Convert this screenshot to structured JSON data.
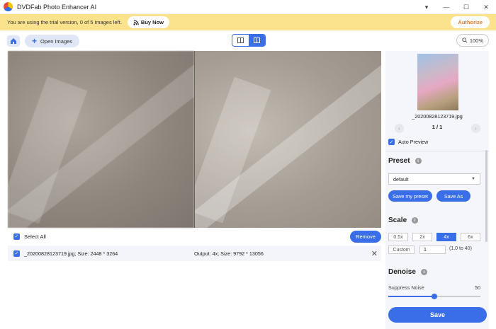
{
  "app": {
    "title": "DVDFab Photo Enhancer AI",
    "win_pin": "▾",
    "win_min": "—",
    "win_max": "☐",
    "win_close": "✕"
  },
  "trial": {
    "message": "You are using the trial version, 0 of 5 images left.",
    "buy_label": "Buy Now",
    "authorize_label": "Authorize"
  },
  "toolbar": {
    "open_label": "Open Images",
    "zoom": "100%"
  },
  "list": {
    "select_all_label": "Select All",
    "remove_label": "Remove",
    "file": {
      "name": "_20200828123719.jpg; Size: 2448 * 3264",
      "output": "Output: 4x; Size: 9792 * 13056"
    }
  },
  "sidebar": {
    "thumb_name": "_20200828123719.jpg",
    "pager": "1 / 1",
    "auto_preview_label": "Auto Preview",
    "preset": {
      "title": "Preset",
      "value": "default",
      "save_my_preset": "Save my preset",
      "save_as": "Save As"
    },
    "scale": {
      "title": "Scale",
      "options": [
        "0.5x",
        "2x",
        "4x",
        "6x"
      ],
      "selected": "4x",
      "custom_label": "Custom",
      "custom_value": "1",
      "custom_range": "(1.0 to 40)"
    },
    "denoise": {
      "title": "Denoise",
      "suppress_label": "Suppress Noise",
      "suppress_value": "50",
      "suppress_fraction": 0.5
    },
    "save_label": "Save"
  },
  "colors": {
    "accent": "#3a6ee8",
    "trial_bg": "#fbe38e",
    "authorize_text": "#e07a2a"
  }
}
